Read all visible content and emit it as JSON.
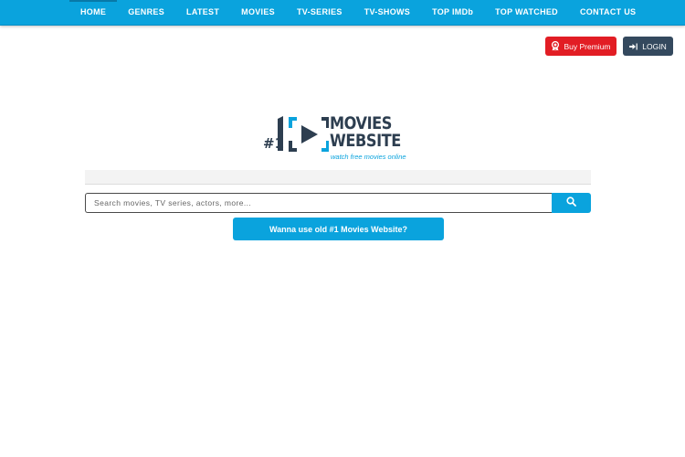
{
  "nav": {
    "items": [
      {
        "label": "HOME"
      },
      {
        "label": "GENRES"
      },
      {
        "label": "LATEST"
      },
      {
        "label": "MOVIES"
      },
      {
        "label": "TV-SERIES"
      },
      {
        "label": "TV-SHOWS"
      },
      {
        "label": "TOP IMDb"
      },
      {
        "label": "TOP WATCHED"
      },
      {
        "label": "CONTACT US"
      }
    ]
  },
  "account": {
    "premium_label": "Buy Premium",
    "login_label": "LOGIN"
  },
  "logo": {
    "hash": "#1",
    "word1": "MOVIES",
    "word2": "WEBSITE",
    "tagline": "watch free movies online"
  },
  "search": {
    "placeholder": "Search movies, TV series, actors, more..."
  },
  "old_site_button": {
    "label": "Wanna use old #1 Movies Website?"
  },
  "icons": {
    "premium": "award-ribbon-icon",
    "login": "sign-in-icon",
    "search": "search-icon"
  },
  "colors": {
    "brand": "#0aa3dd",
    "premium": "#e21d24",
    "login": "#34495e",
    "logo_text": "#2d3e50"
  }
}
